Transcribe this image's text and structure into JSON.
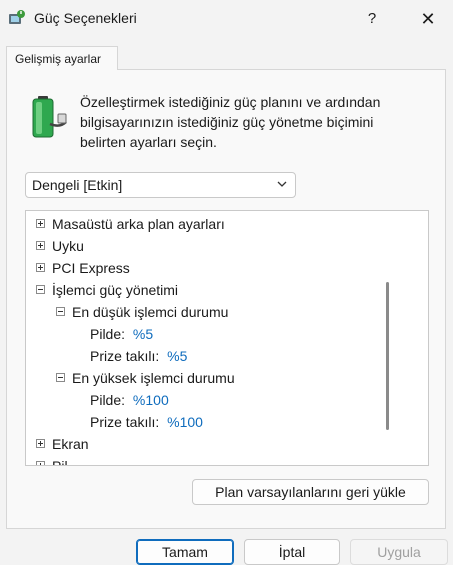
{
  "window": {
    "title": "Güç Seçenekleri",
    "help": "?",
    "close": "✕"
  },
  "tab": {
    "label": "Gelişmiş ayarlar"
  },
  "description": "Özelleştirmek istediğiniz güç planını ve ardından bilgisayarınızın istediğiniz güç yönetme biçimini belirten ayarları seçin.",
  "plan_select": {
    "value": "Dengeli [Etkin]"
  },
  "tree": {
    "items": [
      {
        "label": "Masaüstü arka plan ayarları",
        "expander": "plus"
      },
      {
        "label": "Uyku",
        "expander": "plus"
      },
      {
        "label": "PCI Express",
        "expander": "plus"
      },
      {
        "label": "İşlemci güç yönetimi",
        "expander": "minus"
      },
      {
        "label": "En düşük işlemci durumu",
        "expander": "minus"
      },
      {
        "label": "Pilde:",
        "value": "%5"
      },
      {
        "label": "Prize takılı:",
        "value": "%5"
      },
      {
        "label": "En yüksek işlemci durumu",
        "expander": "minus"
      },
      {
        "label": "Pilde:",
        "value": "%100"
      },
      {
        "label": "Prize takılı:",
        "value": "%100"
      },
      {
        "label": "Ekran",
        "expander": "plus"
      },
      {
        "label": "Pil",
        "expander": "plus"
      }
    ]
  },
  "buttons": {
    "restore": "Plan varsayılanlarını geri yükle",
    "ok": "Tamam",
    "cancel": "İptal",
    "apply": "Uygula"
  },
  "colors": {
    "accent": "#0f6cbd",
    "battery_green": "#2fa84f"
  },
  "icons": {
    "app": "power-options-icon",
    "battery": "battery-icon",
    "dropdown": "chevron-down-icon"
  }
}
